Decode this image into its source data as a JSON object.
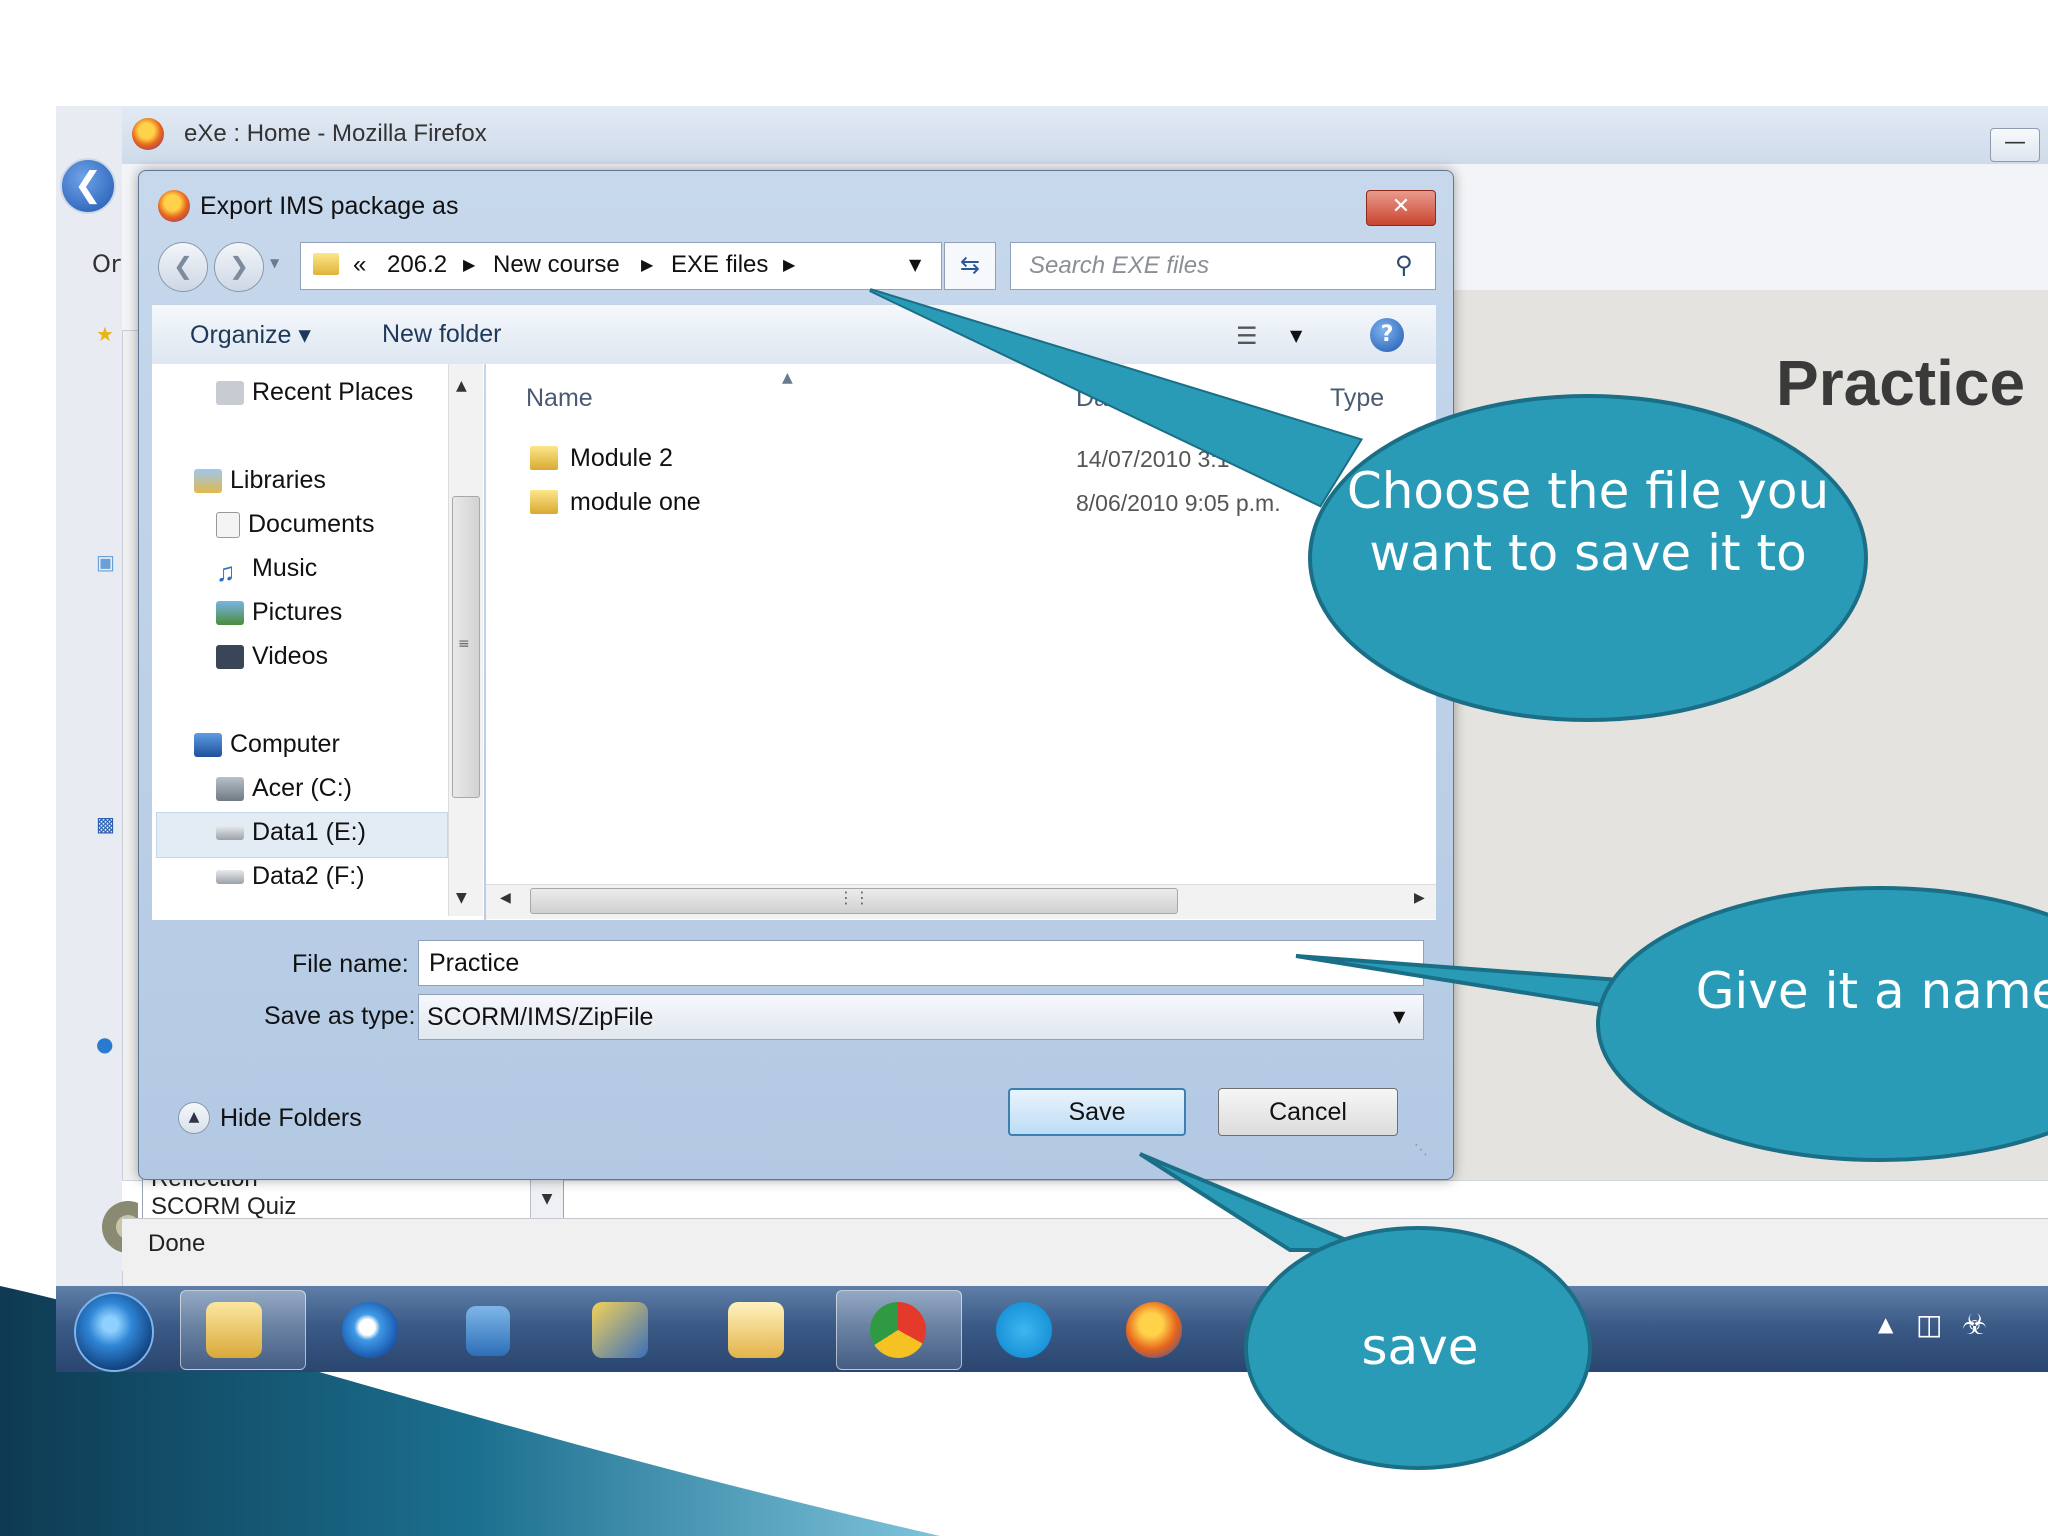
{
  "browser": {
    "title": "eXe : Home - Mozilla Firefox",
    "menu_stub": "Or",
    "page_heading": "Practice",
    "status": "Done",
    "outline_items": [
      "Reflection",
      "SCORM Quiz"
    ]
  },
  "dialog": {
    "title": "Export IMS package as",
    "breadcrumb": [
      "«",
      "206.2",
      "New course",
      "EXE files"
    ],
    "search_placeholder": "Search EXE files",
    "toolbar": {
      "organize": "Organize ▾",
      "new_folder": "New folder"
    },
    "nav_items": [
      {
        "label": "Recent Places",
        "icon": "recent-places-icon"
      },
      {
        "label": "Libraries",
        "icon": "libraries-icon"
      },
      {
        "label": "Documents",
        "icon": "documents-icon"
      },
      {
        "label": "Music",
        "icon": "music-icon"
      },
      {
        "label": "Pictures",
        "icon": "pictures-icon"
      },
      {
        "label": "Videos",
        "icon": "videos-icon"
      },
      {
        "label": "Computer",
        "icon": "computer-icon"
      },
      {
        "label": "Acer (C:)",
        "icon": "drive-icon"
      },
      {
        "label": "Data1 (E:)",
        "icon": "drive-icon"
      },
      {
        "label": "Data2 (F:)",
        "icon": "drive-icon"
      }
    ],
    "columns": {
      "name": "Name",
      "date": "Da",
      "type": "Type"
    },
    "files": [
      {
        "name": "Module 2",
        "date": "14/07/2010 3:1"
      },
      {
        "name": "module one",
        "date": "8/06/2010 9:05 p.m."
      }
    ],
    "file_name_label": "File name:",
    "file_name_value": "Practice",
    "save_type_label": "Save as type:",
    "save_type_value": "SCORM/IMS/ZipFile",
    "hide_folders": "Hide Folders",
    "save_button": "Save",
    "cancel_button": "Cancel"
  },
  "callouts": {
    "folder": "Choose the file you want to save it to",
    "name": "Give it a name",
    "save": "save"
  },
  "colors": {
    "callout_fill": "#2a9bb7",
    "callout_border": "#1a6f86",
    "swoosh": "#1b6f8e",
    "taskbar": "#3b5a86"
  }
}
